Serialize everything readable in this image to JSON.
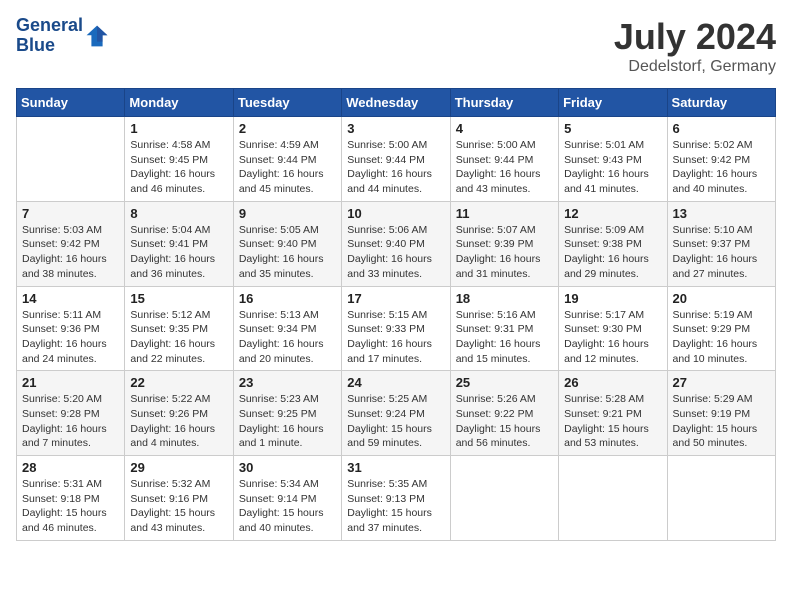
{
  "logo": {
    "line1": "General",
    "line2": "Blue"
  },
  "title": "July 2024",
  "location": "Dedelstorf, Germany",
  "header_days": [
    "Sunday",
    "Monday",
    "Tuesday",
    "Wednesday",
    "Thursday",
    "Friday",
    "Saturday"
  ],
  "weeks": [
    [
      {
        "day": "",
        "info": ""
      },
      {
        "day": "1",
        "info": "Sunrise: 4:58 AM\nSunset: 9:45 PM\nDaylight: 16 hours\nand 46 minutes."
      },
      {
        "day": "2",
        "info": "Sunrise: 4:59 AM\nSunset: 9:44 PM\nDaylight: 16 hours\nand 45 minutes."
      },
      {
        "day": "3",
        "info": "Sunrise: 5:00 AM\nSunset: 9:44 PM\nDaylight: 16 hours\nand 44 minutes."
      },
      {
        "day": "4",
        "info": "Sunrise: 5:00 AM\nSunset: 9:44 PM\nDaylight: 16 hours\nand 43 minutes."
      },
      {
        "day": "5",
        "info": "Sunrise: 5:01 AM\nSunset: 9:43 PM\nDaylight: 16 hours\nand 41 minutes."
      },
      {
        "day": "6",
        "info": "Sunrise: 5:02 AM\nSunset: 9:42 PM\nDaylight: 16 hours\nand 40 minutes."
      }
    ],
    [
      {
        "day": "7",
        "info": "Sunrise: 5:03 AM\nSunset: 9:42 PM\nDaylight: 16 hours\nand 38 minutes."
      },
      {
        "day": "8",
        "info": "Sunrise: 5:04 AM\nSunset: 9:41 PM\nDaylight: 16 hours\nand 36 minutes."
      },
      {
        "day": "9",
        "info": "Sunrise: 5:05 AM\nSunset: 9:40 PM\nDaylight: 16 hours\nand 35 minutes."
      },
      {
        "day": "10",
        "info": "Sunrise: 5:06 AM\nSunset: 9:40 PM\nDaylight: 16 hours\nand 33 minutes."
      },
      {
        "day": "11",
        "info": "Sunrise: 5:07 AM\nSunset: 9:39 PM\nDaylight: 16 hours\nand 31 minutes."
      },
      {
        "day": "12",
        "info": "Sunrise: 5:09 AM\nSunset: 9:38 PM\nDaylight: 16 hours\nand 29 minutes."
      },
      {
        "day": "13",
        "info": "Sunrise: 5:10 AM\nSunset: 9:37 PM\nDaylight: 16 hours\nand 27 minutes."
      }
    ],
    [
      {
        "day": "14",
        "info": "Sunrise: 5:11 AM\nSunset: 9:36 PM\nDaylight: 16 hours\nand 24 minutes."
      },
      {
        "day": "15",
        "info": "Sunrise: 5:12 AM\nSunset: 9:35 PM\nDaylight: 16 hours\nand 22 minutes."
      },
      {
        "day": "16",
        "info": "Sunrise: 5:13 AM\nSunset: 9:34 PM\nDaylight: 16 hours\nand 20 minutes."
      },
      {
        "day": "17",
        "info": "Sunrise: 5:15 AM\nSunset: 9:33 PM\nDaylight: 16 hours\nand 17 minutes."
      },
      {
        "day": "18",
        "info": "Sunrise: 5:16 AM\nSunset: 9:31 PM\nDaylight: 16 hours\nand 15 minutes."
      },
      {
        "day": "19",
        "info": "Sunrise: 5:17 AM\nSunset: 9:30 PM\nDaylight: 16 hours\nand 12 minutes."
      },
      {
        "day": "20",
        "info": "Sunrise: 5:19 AM\nSunset: 9:29 PM\nDaylight: 16 hours\nand 10 minutes."
      }
    ],
    [
      {
        "day": "21",
        "info": "Sunrise: 5:20 AM\nSunset: 9:28 PM\nDaylight: 16 hours\nand 7 minutes."
      },
      {
        "day": "22",
        "info": "Sunrise: 5:22 AM\nSunset: 9:26 PM\nDaylight: 16 hours\nand 4 minutes."
      },
      {
        "day": "23",
        "info": "Sunrise: 5:23 AM\nSunset: 9:25 PM\nDaylight: 16 hours\nand 1 minute."
      },
      {
        "day": "24",
        "info": "Sunrise: 5:25 AM\nSunset: 9:24 PM\nDaylight: 15 hours\nand 59 minutes."
      },
      {
        "day": "25",
        "info": "Sunrise: 5:26 AM\nSunset: 9:22 PM\nDaylight: 15 hours\nand 56 minutes."
      },
      {
        "day": "26",
        "info": "Sunrise: 5:28 AM\nSunset: 9:21 PM\nDaylight: 15 hours\nand 53 minutes."
      },
      {
        "day": "27",
        "info": "Sunrise: 5:29 AM\nSunset: 9:19 PM\nDaylight: 15 hours\nand 50 minutes."
      }
    ],
    [
      {
        "day": "28",
        "info": "Sunrise: 5:31 AM\nSunset: 9:18 PM\nDaylight: 15 hours\nand 46 minutes."
      },
      {
        "day": "29",
        "info": "Sunrise: 5:32 AM\nSunset: 9:16 PM\nDaylight: 15 hours\nand 43 minutes."
      },
      {
        "day": "30",
        "info": "Sunrise: 5:34 AM\nSunset: 9:14 PM\nDaylight: 15 hours\nand 40 minutes."
      },
      {
        "day": "31",
        "info": "Sunrise: 5:35 AM\nSunset: 9:13 PM\nDaylight: 15 hours\nand 37 minutes."
      },
      {
        "day": "",
        "info": ""
      },
      {
        "day": "",
        "info": ""
      },
      {
        "day": "",
        "info": ""
      }
    ]
  ]
}
